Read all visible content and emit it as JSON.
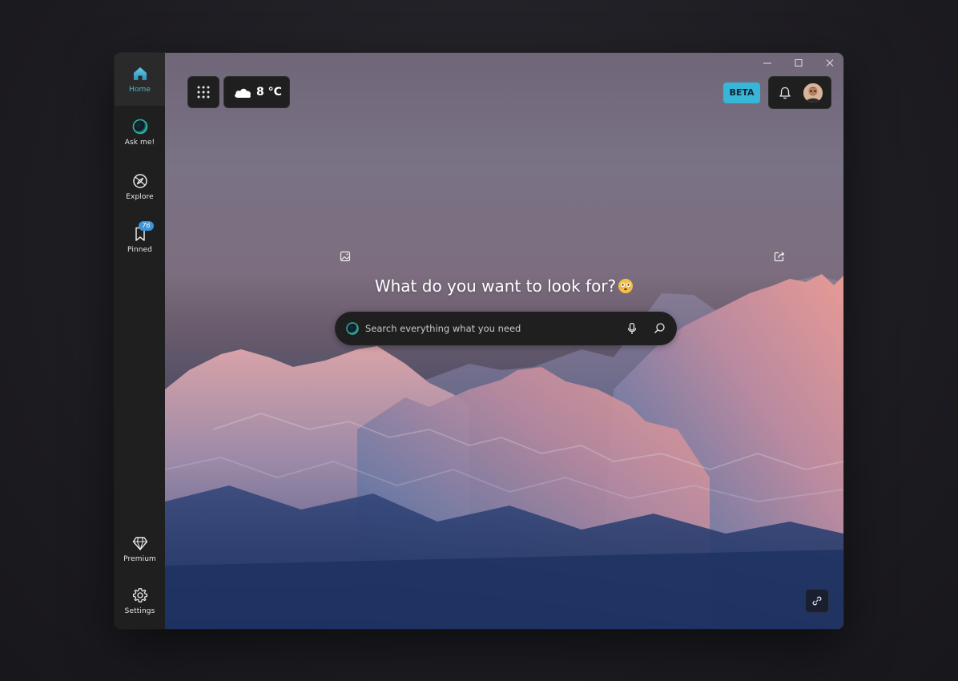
{
  "sidebar": {
    "items": [
      {
        "label": "Home",
        "icon": "home-icon",
        "active": true
      },
      {
        "label": "Ask me!",
        "icon": "orb-icon"
      },
      {
        "label": "Explore",
        "icon": "compass-icon"
      },
      {
        "label": "Pinned",
        "icon": "bookmark-icon",
        "badge": "76"
      },
      {
        "label": "Premium",
        "icon": "diamond-icon"
      },
      {
        "label": "Settings",
        "icon": "gear-icon"
      }
    ]
  },
  "header": {
    "weather": {
      "temperature": "8 °C",
      "icon": "cloud-icon"
    },
    "beta_label": "BETA"
  },
  "hero": {
    "headline": "What do you want to look for?",
    "emoji": "flushed-face-emoji"
  },
  "search": {
    "placeholder": "Search everything what you need"
  },
  "colors": {
    "accent": "#3aa7c1",
    "beta_bg": "#38b6d8",
    "badge_bg": "#3d94d6",
    "sidebar_bg": "#201f1f",
    "tile_bg": "#1f1f20"
  }
}
